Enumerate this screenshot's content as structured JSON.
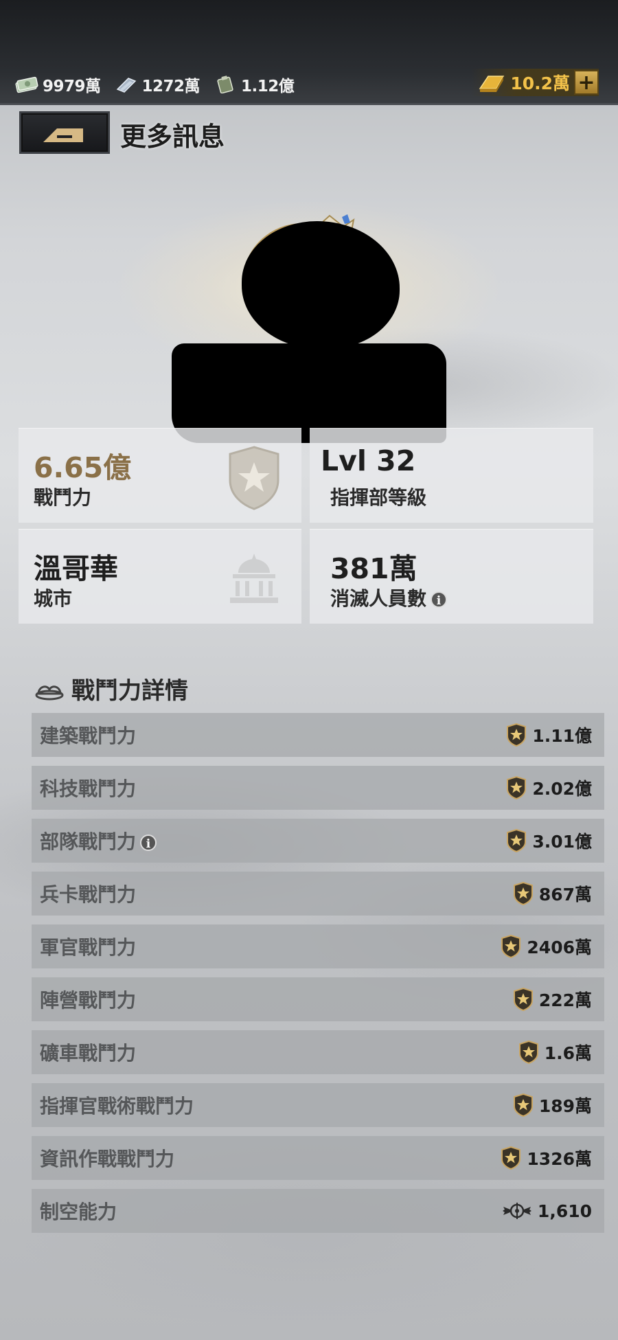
{
  "resources": [
    {
      "icon": "cash-stack-icon",
      "value": "9979萬"
    },
    {
      "icon": "steel-bar-icon",
      "value": "1272萬"
    },
    {
      "icon": "oil-canister-icon",
      "value": "1.12億"
    }
  ],
  "gold": {
    "icon": "gold-bar-icon",
    "value": "10.2萬",
    "add_label": "+"
  },
  "header": {
    "title": "更多訊息"
  },
  "stats": {
    "power": {
      "value": "6.65億",
      "label": "戰鬥力"
    },
    "level": {
      "value": "Lvl 32",
      "label": "指揮部等級"
    },
    "city": {
      "value": "溫哥華",
      "label": "城市"
    },
    "kills": {
      "value": "381萬",
      "label": "消滅人員數"
    }
  },
  "details": {
    "title": "戰鬥力詳情",
    "rows": [
      {
        "label": "建築戰鬥力",
        "value": "1.11億",
        "icon": "star-shield-icon"
      },
      {
        "label": "科技戰鬥力",
        "value": "2.02億",
        "icon": "star-shield-icon"
      },
      {
        "label": "部隊戰鬥力",
        "value": "3.01億",
        "icon": "star-shield-icon",
        "info": true
      },
      {
        "label": "兵卡戰鬥力",
        "value": "867萬",
        "icon": "star-shield-icon"
      },
      {
        "label": "軍官戰鬥力",
        "value": "2406萬",
        "icon": "star-shield-icon"
      },
      {
        "label": "陣營戰鬥力",
        "value": "222萬",
        "icon": "star-shield-icon"
      },
      {
        "label": "礦車戰鬥力",
        "value": "1.6萬",
        "icon": "star-shield-icon"
      },
      {
        "label": "指揮官戰術戰鬥力",
        "value": "189萬",
        "icon": "star-shield-icon"
      },
      {
        "label": "資訊作戰戰鬥力",
        "value": "1326萬",
        "icon": "star-shield-icon"
      },
      {
        "label": "制空能力",
        "value": "1,610",
        "icon": "winged-target-icon"
      }
    ]
  },
  "colors": {
    "power_value": "#8a7048",
    "gold": "#f3c24a"
  }
}
